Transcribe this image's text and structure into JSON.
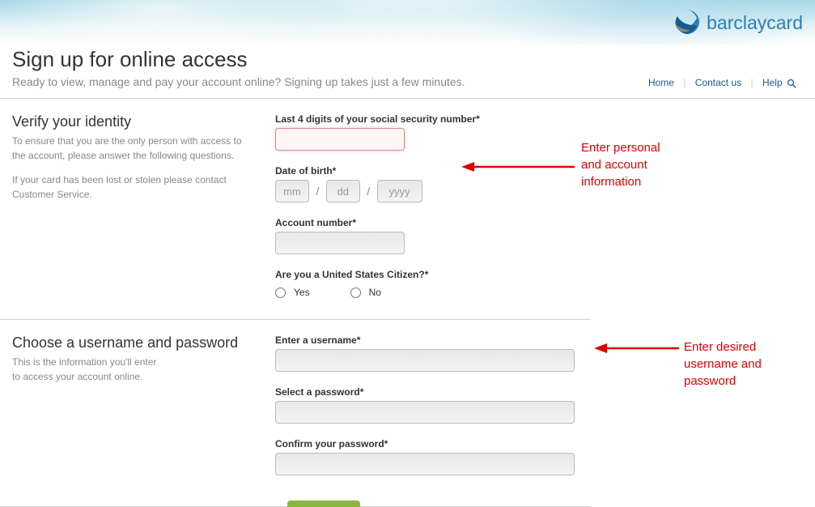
{
  "brand": {
    "name": "barclaycard"
  },
  "nav": {
    "home": "Home",
    "contact": "Contact us",
    "help": "Help"
  },
  "header": {
    "title": "Sign up for online access",
    "subtitle": "Ready to view, manage and pay your account online? Signing up takes just a few minutes."
  },
  "identity": {
    "heading": "Verify your identity",
    "desc1": "To ensure that you are the only person with access to the account, please answer the following questions.",
    "desc2": "If your card has been lost or stolen please contact Customer Service.",
    "ssn_label": "Last 4 digits of your social security number*",
    "dob_label": "Date of birth*",
    "dob_mm_ph": "mm",
    "dob_dd_ph": "dd",
    "dob_yyyy_ph": "yyyy",
    "acct_label": "Account number*",
    "citizen_label": "Are you a United States Citizen?*",
    "citizen_yes": "Yes",
    "citizen_no": "No"
  },
  "credentials": {
    "heading": "Choose a username and password",
    "desc": "This is the information you'll enter\nto access your account online.",
    "username_label": "Enter a username*",
    "password_label": "Select a password*",
    "confirm_label": "Confirm your password*"
  },
  "annotations": {
    "a1": "Enter personal\nand account\ninformation",
    "a2": "Enter desired\nusername and\npassword"
  }
}
